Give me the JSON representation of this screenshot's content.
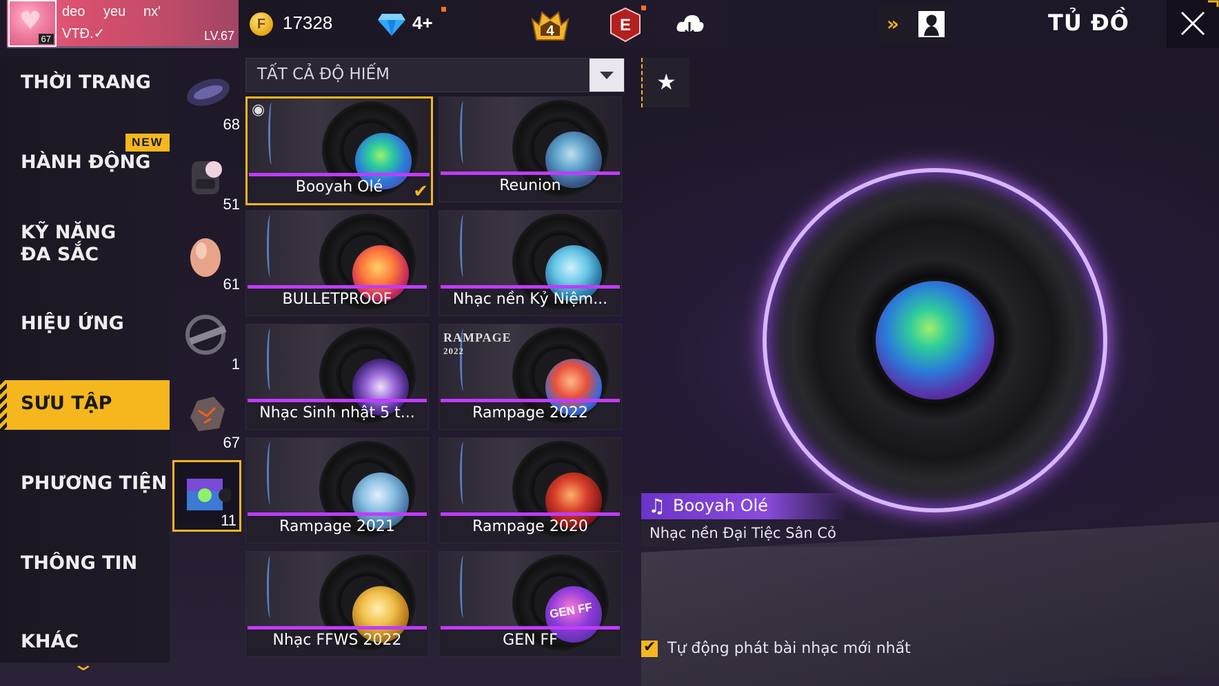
{
  "profile": {
    "name_line1_a": "deo",
    "name_line1_b": "yeu",
    "name_line1_c": "nx'",
    "name_line2": "VTĐ.✓",
    "avatar_level": "67",
    "level": "LV.67"
  },
  "currency": {
    "gold": "17328",
    "diamonds": "4+"
  },
  "badges": {
    "rank_number": "4",
    "elite_letter": "E"
  },
  "header": {
    "title": "TỦ ĐỒ",
    "fast_arrows": "»"
  },
  "nav": {
    "items": [
      {
        "label": "THỜI TRANG"
      },
      {
        "label": "HÀNH ĐỘNG"
      },
      {
        "label": "KỸ NĂNG ĐA SẮC"
      },
      {
        "label": "HIỆU ỨNG"
      },
      {
        "label": "SƯU TẬP"
      },
      {
        "label": "PHƯƠNG TIỆN"
      },
      {
        "label": "THÔNG TIN"
      },
      {
        "label": "KHÁC"
      }
    ],
    "new_badge": "NEW",
    "more_chevron": "⌄"
  },
  "subcategories": [
    {
      "count": "68"
    },
    {
      "count": "51"
    },
    {
      "count": "61"
    },
    {
      "count": "1"
    },
    {
      "count": "67"
    },
    {
      "count": "11"
    }
  ],
  "filter": {
    "label": "TẤT CẢ ĐỘ HIẾM"
  },
  "items": [
    {
      "title": "Booyah Olé"
    },
    {
      "title": "Reunion"
    },
    {
      "title": "BULLETPROOF"
    },
    {
      "title": "Nhạc nền Kỷ Niệm..."
    },
    {
      "title": "Nhạc Sinh nhật 5 t..."
    },
    {
      "title": "Rampage 2022",
      "wordmark": "RAMPAGE",
      "wordmark_year": "2022"
    },
    {
      "title": "Rampage 2021"
    },
    {
      "title": "Rampage 2020"
    },
    {
      "title": "Nhạc FFWS 2022"
    },
    {
      "title": "GEN FF",
      "disc_text": "GEN FF"
    }
  ],
  "now_playing": {
    "title": "Booyah Olé",
    "subtitle": "Nhạc nền Đại Tiệc Sân Cỏ"
  },
  "autoplay": {
    "label": "Tự động phát bài nhạc mới nhất",
    "checked": true
  },
  "colors": {
    "accent": "#f5b71d",
    "progress": "#c03bff",
    "ring_glow": "#b463ff"
  }
}
